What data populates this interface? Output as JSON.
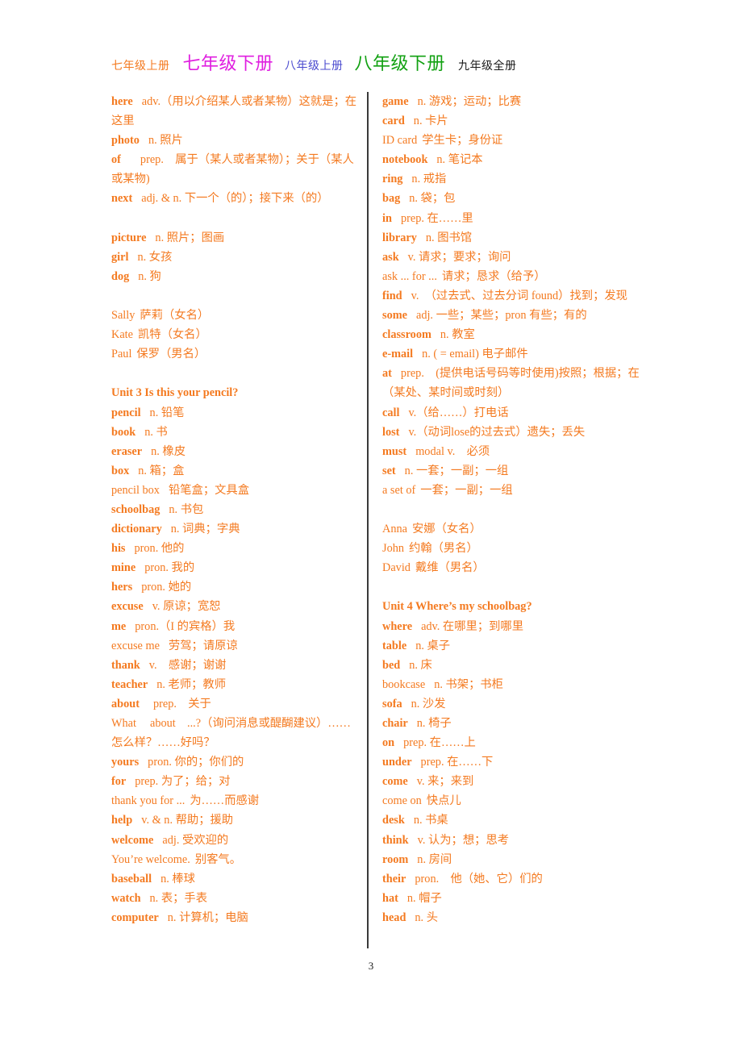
{
  "page": {
    "number": "3",
    "text_color": "#F47A20",
    "divider_color": "#3a3a3a"
  },
  "tabs": [
    {
      "label": "七年级上册",
      "color": "#F47A20",
      "size": "sm"
    },
    {
      "label": "七年级下册",
      "color": "#E020E0",
      "size": "lg"
    },
    {
      "label": "八年级上册",
      "color": "#4A4ACF",
      "size": "sm"
    },
    {
      "label": "八年级下册",
      "color": "#12A112",
      "size": "lg"
    },
    {
      "label": "九年级全册",
      "color": "#1a1a1a",
      "size": "sm"
    }
  ],
  "left_column": [
    {
      "type": "entry",
      "head": "here",
      "bold": true,
      "gap": "gap2",
      "body": "adv.（用以介绍某人或者某物）这就是；在这里"
    },
    {
      "type": "entry",
      "head": "photo",
      "bold": true,
      "gap": "gap2",
      "body": "n. 照片"
    },
    {
      "type": "entry",
      "head": "of",
      "bold": true,
      "gap": "gap4",
      "body": "prep.　属于（某人或者某物）；关于（某人或某物)"
    },
    {
      "type": "entry",
      "head": "next",
      "bold": true,
      "gap": "gap2",
      "body": "adj. & n. 下一个（的）；接下来（的）"
    },
    {
      "type": "spacer"
    },
    {
      "type": "entry",
      "head": "picture",
      "bold": true,
      "gap": "gap2",
      "body": "n. 照片；图画"
    },
    {
      "type": "entry",
      "head": "girl",
      "bold": true,
      "gap": "gap2",
      "body": "n. 女孩"
    },
    {
      "type": "entry",
      "head": "dog",
      "bold": true,
      "gap": "gap2",
      "body": "n. 狗"
    },
    {
      "type": "spacer"
    },
    {
      "type": "entry",
      "head": "Sally",
      "bold": false,
      "gap": "gap1",
      "body": "萨莉（女名）"
    },
    {
      "type": "entry",
      "head": "Kate",
      "bold": false,
      "gap": "gap1",
      "body": "凯特（女名）"
    },
    {
      "type": "entry",
      "head": "Paul",
      "bold": false,
      "gap": "gap1",
      "body": "保罗（男名）"
    },
    {
      "type": "spacer"
    },
    {
      "type": "unit",
      "label": "Unit 3 Is this your pencil?"
    },
    {
      "type": "entry",
      "head": "pencil",
      "bold": true,
      "gap": "gap2",
      "body": "n. 铅笔"
    },
    {
      "type": "entry",
      "head": "book",
      "bold": true,
      "gap": "gap2",
      "body": "n. 书"
    },
    {
      "type": "entry",
      "head": "eraser",
      "bold": true,
      "gap": "gap2",
      "body": "n. 橡皮"
    },
    {
      "type": "entry",
      "head": "box",
      "bold": true,
      "gap": "gap2",
      "body": "n. 箱；盒"
    },
    {
      "type": "entry",
      "head": "pencil box",
      "bold": false,
      "gap": "gap2",
      "body": "铅笔盒；文具盒"
    },
    {
      "type": "entry",
      "head": "schoolbag",
      "bold": true,
      "gap": "gap2",
      "body": "n. 书包"
    },
    {
      "type": "entry",
      "head": "dictionary",
      "bold": true,
      "gap": "gap2",
      "body": "n. 词典；字典"
    },
    {
      "type": "entry",
      "head": "his",
      "bold": true,
      "gap": "gap2",
      "body": "pron. 他的"
    },
    {
      "type": "entry",
      "head": "mine",
      "bold": true,
      "gap": "gap2",
      "body": "pron. 我的"
    },
    {
      "type": "entry",
      "head": "hers",
      "bold": true,
      "gap": "gap2",
      "body": "pron. 她的"
    },
    {
      "type": "entry",
      "head": "excuse",
      "bold": true,
      "gap": "gap2",
      "body": "v. 原谅；宽恕"
    },
    {
      "type": "entry",
      "head": "me",
      "bold": true,
      "gap": "gap2",
      "body": "pron.（I 的宾格）我"
    },
    {
      "type": "entry",
      "head": "excuse me",
      "bold": false,
      "gap": "gap2",
      "body": "劳驾；请原谅"
    },
    {
      "type": "entry",
      "head": "thank",
      "bold": true,
      "gap": "gap2",
      "body": "v.　感谢；谢谢"
    },
    {
      "type": "entry",
      "head": "teacher",
      "bold": true,
      "gap": "gap2",
      "body": "n. 老师；教师"
    },
    {
      "type": "entry",
      "head": "about",
      "bold": true,
      "gap": "gap3",
      "body": "prep.　关于"
    },
    {
      "type": "entry",
      "head": "What",
      "bold": false,
      "gap": "gap3",
      "body": "about　...?（询问消息或醍醐建议）……"
    },
    {
      "type": "entry",
      "head": "",
      "bold": false,
      "gap": "gap1",
      "body": "怎么样？……好吗？"
    },
    {
      "type": "entry",
      "head": "yours",
      "bold": true,
      "gap": "gap2",
      "body": "pron. 你的；你们的"
    },
    {
      "type": "entry",
      "head": "for",
      "bold": true,
      "gap": "gap2",
      "body": "prep. 为了；给；对"
    },
    {
      "type": "entry",
      "head": "thank you for ...",
      "bold": false,
      "gap": "gap1",
      "body": "为……而感谢"
    },
    {
      "type": "entry",
      "head": "help",
      "bold": true,
      "gap": "gap2",
      "body": "v. & n. 帮助；援助"
    },
    {
      "type": "entry",
      "head": "welcome",
      "bold": true,
      "gap": "gap2",
      "body": "adj. 受欢迎的"
    },
    {
      "type": "entry",
      "head": "You’re welcome.",
      "bold": false,
      "gap": "gap1",
      "body": "别客气。"
    },
    {
      "type": "entry",
      "head": "baseball",
      "bold": true,
      "gap": "gap2",
      "body": "n. 棒球"
    },
    {
      "type": "entry",
      "head": "watch",
      "bold": true,
      "gap": "gap2",
      "body": "n. 表；手表"
    },
    {
      "type": "entry",
      "head": "computer",
      "bold": true,
      "gap": "gap2",
      "body": "n. 计算机；电脑"
    }
  ],
  "right_column": [
    {
      "type": "entry",
      "head": "game",
      "bold": true,
      "gap": "gap2",
      "body": "n. 游戏；运动；比赛"
    },
    {
      "type": "entry",
      "head": "card",
      "bold": true,
      "gap": "gap2",
      "body": "n. 卡片"
    },
    {
      "type": "entry",
      "head": "ID card",
      "bold": false,
      "gap": "gap1",
      "body": "学生卡；身份证"
    },
    {
      "type": "entry",
      "head": "notebook",
      "bold": true,
      "gap": "gap2",
      "body": "n. 笔记本"
    },
    {
      "type": "entry",
      "head": "ring",
      "bold": true,
      "gap": "gap2",
      "body": "n. 戒指"
    },
    {
      "type": "entry",
      "head": "bag",
      "bold": true,
      "gap": "gap2",
      "body": "n. 袋；包"
    },
    {
      "type": "entry",
      "head": "in",
      "bold": true,
      "gap": "gap2",
      "body": "prep. 在……里"
    },
    {
      "type": "entry",
      "head": "library",
      "bold": true,
      "gap": "gap2",
      "body": "n. 图书馆"
    },
    {
      "type": "entry",
      "head": "ask",
      "bold": true,
      "gap": "gap2",
      "body": "v. 请求；要求；询问"
    },
    {
      "type": "entry",
      "head": "ask ... for ...",
      "bold": false,
      "gap": "gap1",
      "body": "请求；恳求（给予）"
    },
    {
      "type": "entry",
      "head": "find",
      "bold": true,
      "gap": "gap2",
      "body": "v.　（过去式、过去分词 found）找到；发现"
    },
    {
      "type": "entry",
      "head": "some",
      "bold": true,
      "gap": "gap2",
      "body": "adj. 一些；某些；pron 有些；有的"
    },
    {
      "type": "entry",
      "head": "classroom",
      "bold": true,
      "gap": "gap2",
      "body": "n. 教室"
    },
    {
      "type": "entry",
      "head": "e-mail",
      "bold": true,
      "gap": "gap2",
      "body": "n. ( = email) 电子邮件"
    },
    {
      "type": "entry",
      "head": "at",
      "bold": true,
      "gap": "gap2",
      "body": "prep.　(提供电话号码等时使用)按照；根据；在（某处、某时间或时刻）"
    },
    {
      "type": "entry",
      "head": "call",
      "bold": true,
      "gap": "gap2",
      "body": "v.（给……）打电话"
    },
    {
      "type": "entry",
      "head": "lost",
      "bold": true,
      "gap": "gap2",
      "body": "v.（动词lose的过去式）遗失；丢失"
    },
    {
      "type": "entry",
      "head": "must",
      "bold": true,
      "gap": "gap2",
      "body": "modal v.　必须"
    },
    {
      "type": "entry",
      "head": "set",
      "bold": true,
      "gap": "gap2",
      "body": "n. 一套；一副；一组"
    },
    {
      "type": "entry",
      "head": "a set of",
      "bold": false,
      "gap": "gap1",
      "body": "一套；一副；一组"
    },
    {
      "type": "spacer"
    },
    {
      "type": "entry",
      "head": "Anna",
      "bold": false,
      "gap": "gap1",
      "body": "安娜（女名）"
    },
    {
      "type": "entry",
      "head": "John",
      "bold": false,
      "gap": "gap1",
      "body": "约翰（男名）"
    },
    {
      "type": "entry",
      "head": "David",
      "bold": false,
      "gap": "gap1",
      "body": "戴维（男名）"
    },
    {
      "type": "spacer"
    },
    {
      "type": "unit",
      "label": "Unit 4 Where’s my schoolbag?"
    },
    {
      "type": "entry",
      "head": "where",
      "bold": true,
      "gap": "gap2",
      "body": "adv. 在哪里；到哪里"
    },
    {
      "type": "entry",
      "head": "table",
      "bold": true,
      "gap": "gap2",
      "body": "n. 桌子"
    },
    {
      "type": "entry",
      "head": "bed",
      "bold": true,
      "gap": "gap2",
      "body": "n. 床"
    },
    {
      "type": "entry",
      "head": "bookcase",
      "bold": false,
      "gap": "gap2",
      "body": "n. 书架；书柜"
    },
    {
      "type": "entry",
      "head": "sofa",
      "bold": true,
      "gap": "gap2",
      "body": "n. 沙发"
    },
    {
      "type": "entry",
      "head": "chair",
      "bold": true,
      "gap": "gap2",
      "body": "n. 椅子"
    },
    {
      "type": "entry",
      "head": "on",
      "bold": true,
      "gap": "gap2",
      "body": "prep. 在……上"
    },
    {
      "type": "entry",
      "head": "under",
      "bold": true,
      "gap": "gap2",
      "body": "prep. 在……下"
    },
    {
      "type": "entry",
      "head": "come",
      "bold": true,
      "gap": "gap2",
      "body": "v. 来；来到"
    },
    {
      "type": "entry",
      "head": "come on",
      "bold": false,
      "gap": "gap1",
      "body": "快点儿"
    },
    {
      "type": "entry",
      "head": "desk",
      "bold": true,
      "gap": "gap2",
      "body": "n. 书桌"
    },
    {
      "type": "entry",
      "head": "think",
      "bold": true,
      "gap": "gap2",
      "body": "v. 认为；想；思考"
    },
    {
      "type": "entry",
      "head": "room",
      "bold": true,
      "gap": "gap2",
      "body": "n. 房间"
    },
    {
      "type": "entry",
      "head": "their",
      "bold": true,
      "gap": "gap2",
      "body": "pron.　他（她、它）们的"
    },
    {
      "type": "entry",
      "head": "hat",
      "bold": true,
      "gap": "gap2",
      "body": "n. 帽子"
    },
    {
      "type": "entry",
      "head": "head",
      "bold": true,
      "gap": "gap2",
      "body": "n. 头"
    }
  ]
}
